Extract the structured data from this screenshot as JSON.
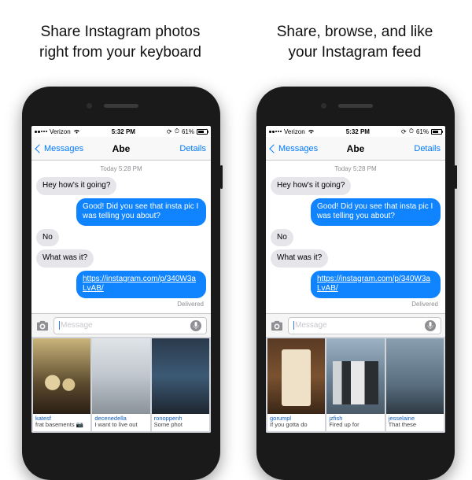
{
  "headlines": {
    "left_line1": "Share Instagram photos",
    "left_line2": "right from your keyboard",
    "right_line1": "Share, browse, and like",
    "right_line2": "your Instagram feed"
  },
  "status": {
    "carrier": "Verizon",
    "time": "5:32 PM",
    "battery": "61%"
  },
  "nav": {
    "back": "Messages",
    "title": "Abe",
    "details": "Details"
  },
  "chat": {
    "timestamp": "Today 5:28 PM",
    "m1": "Hey how's it going?",
    "m2": "Good! Did you see that insta pic I was telling you about?",
    "m3": "No",
    "m4": "What was it?",
    "m5": "https://instagram.com/p/340W3aLvAB/",
    "delivered": "Delivered"
  },
  "input": {
    "placeholder": "Message"
  },
  "grids": {
    "left": [
      {
        "user": "katesf",
        "text": "frat basements 📷",
        "th": "th-a"
      },
      {
        "user": "decenedella",
        "text": "I want to live out",
        "th": "th-b"
      },
      {
        "user": "ronoppenh",
        "text": "Some phot",
        "th": "th-c"
      }
    ],
    "right": [
      {
        "user": "gorumpl",
        "text": "If you gotta do",
        "th": "th-d"
      },
      {
        "user": "jzfish",
        "text": "Fired up for",
        "th": "th-e"
      },
      {
        "user": "jesselaine",
        "text": "That these",
        "th": "th-f"
      }
    ]
  }
}
